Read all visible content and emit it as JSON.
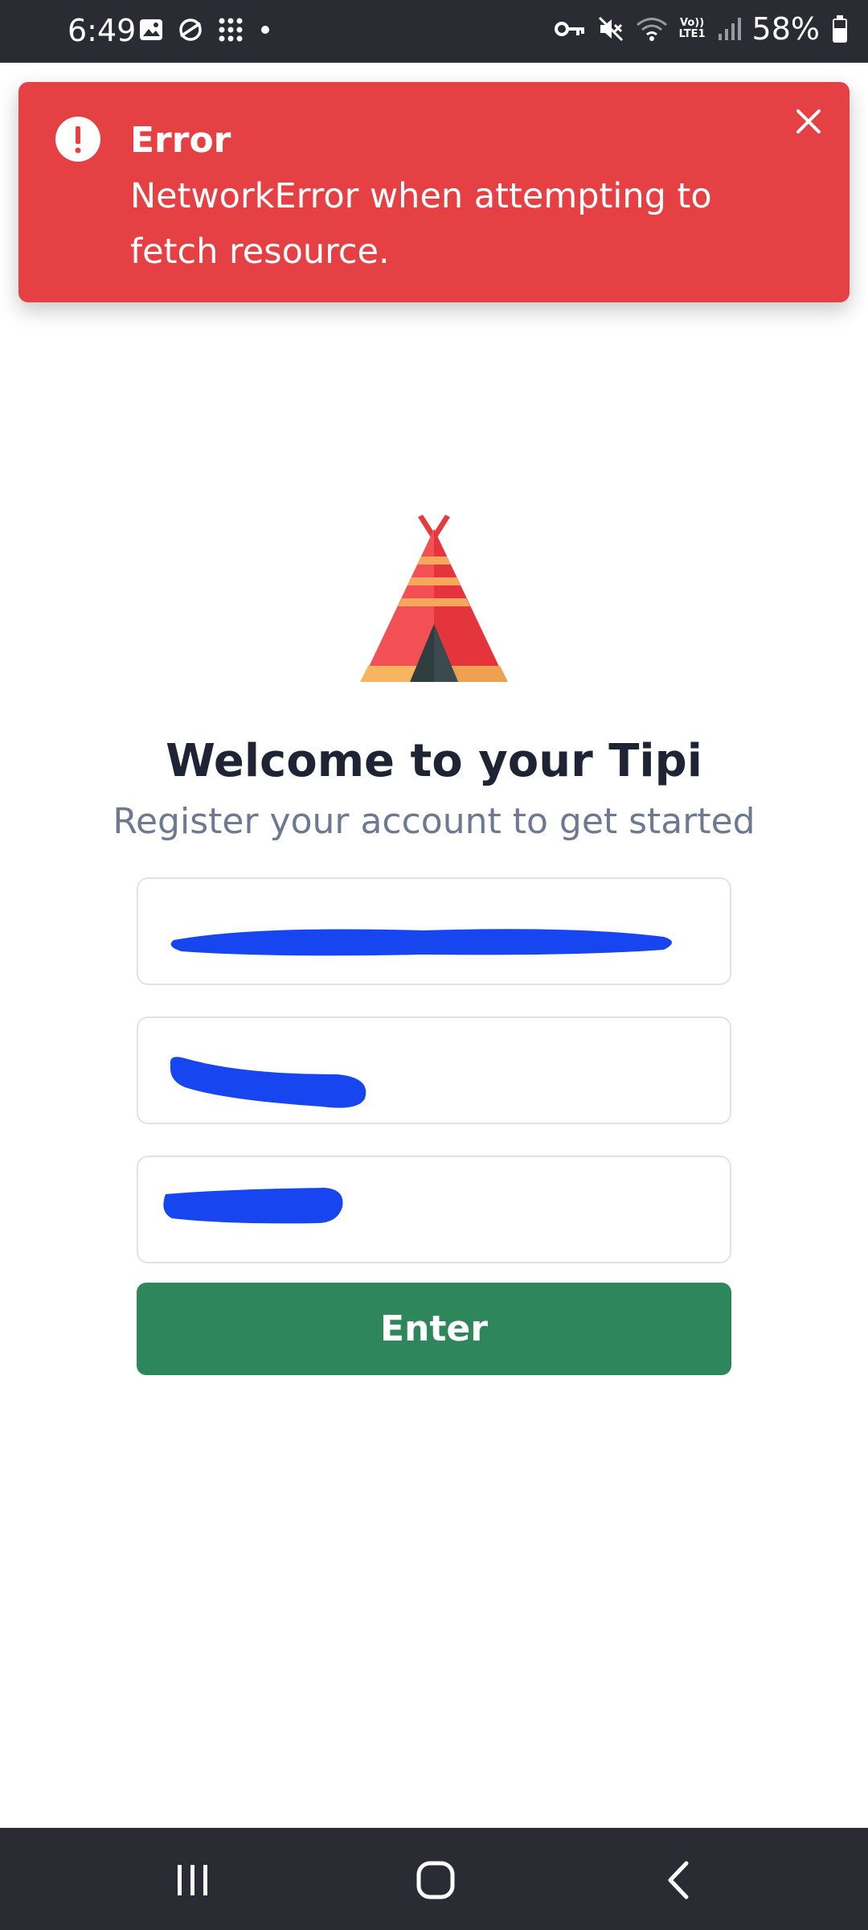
{
  "status_bar": {
    "time": "6:49",
    "battery": "58%",
    "network_label_top": "Vo))",
    "network_label_bottom": "LTE1",
    "icons": [
      "image-icon",
      "chat-icon",
      "apps-grid-icon",
      "dot-icon",
      "key-icon",
      "mute-icon",
      "wifi-icon",
      "signal-icon",
      "battery-icon"
    ]
  },
  "toast": {
    "title": "Error",
    "message": "NetworkError when attempting to fetch resource.",
    "color": "#e54043"
  },
  "page": {
    "title": "Welcome to your Tipi",
    "subtitle": "Register your account to get started"
  },
  "form": {
    "fields": [
      {
        "name": "email",
        "value": "",
        "redacted": true
      },
      {
        "name": "password",
        "value": "",
        "redacted": true
      },
      {
        "name": "confirm-password",
        "value": "",
        "redacted": true
      }
    ],
    "submit_label": "Enter",
    "accent": "#2e875a"
  },
  "nav_bar": {
    "buttons": [
      "recents-icon",
      "home-icon",
      "back-icon"
    ]
  }
}
